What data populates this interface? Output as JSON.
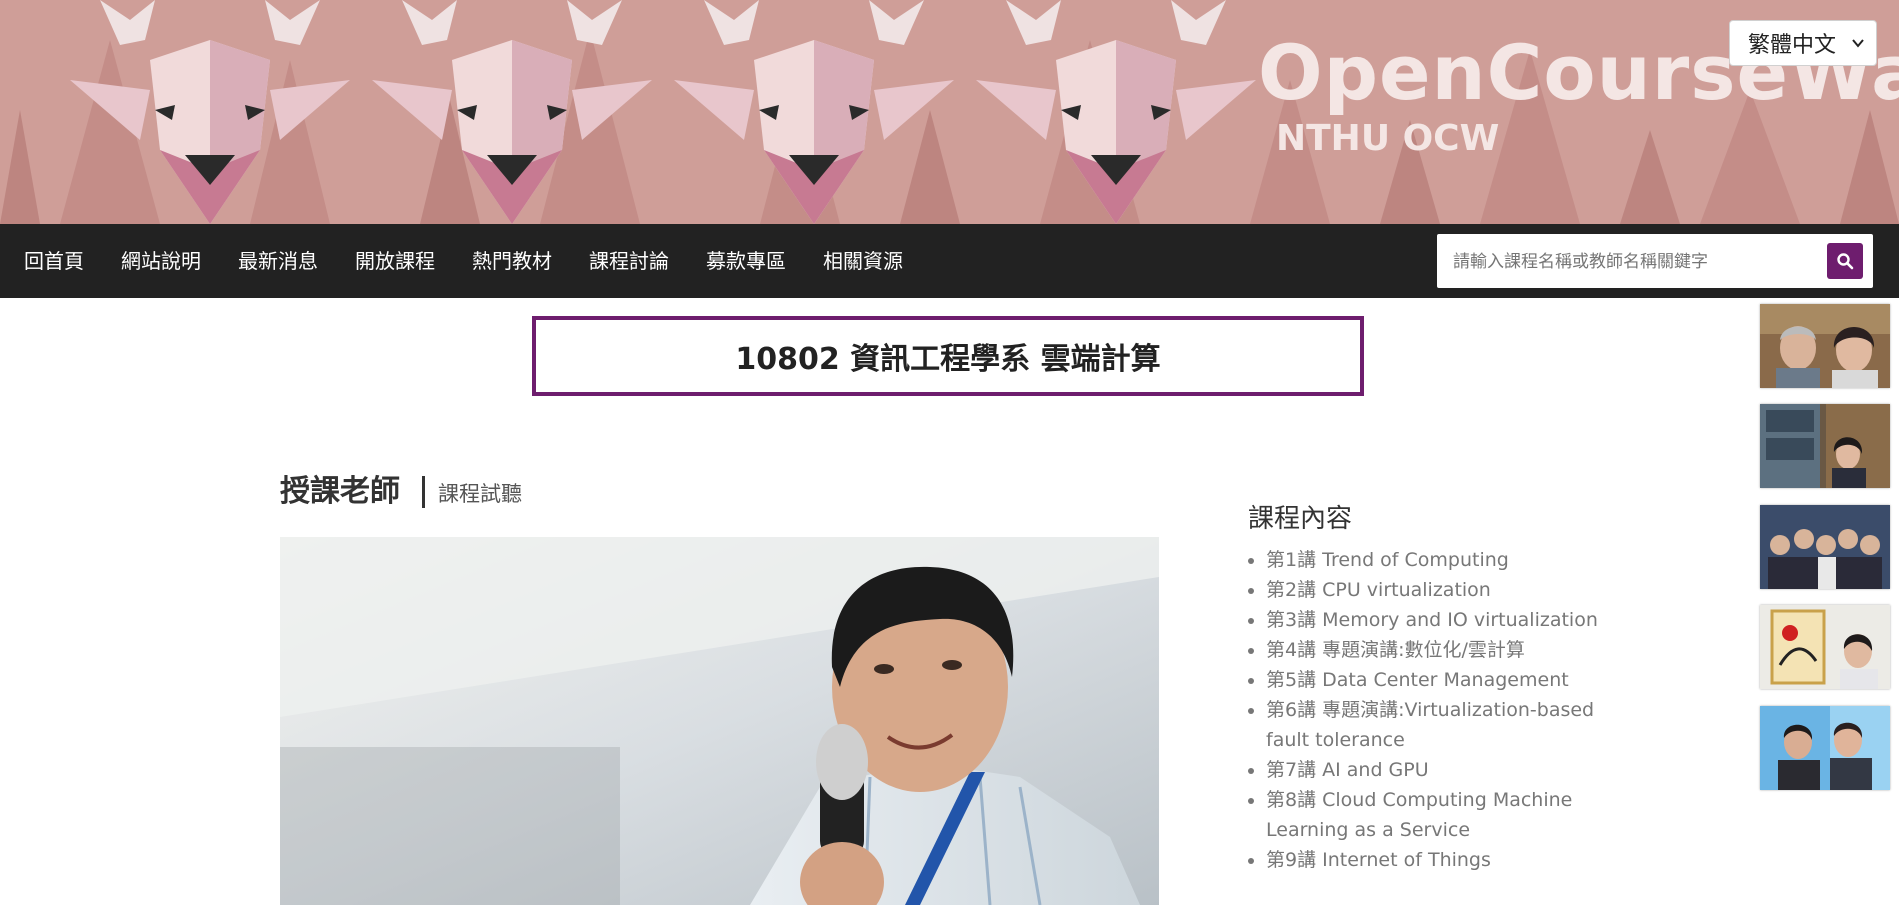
{
  "banner": {
    "brand_title": "OpenCourseWare",
    "brand_subtitle": "NTHU OCW",
    "language": "繁體中文",
    "colors": {
      "background": "#cf9e98",
      "deer_light": "#f2dede",
      "deer_mid": "#c97f95"
    }
  },
  "nav": {
    "items": [
      {
        "label": "回首頁"
      },
      {
        "label": "網站說明"
      },
      {
        "label": "最新消息"
      },
      {
        "label": "開放課程"
      },
      {
        "label": "熱門教材"
      },
      {
        "label": "課程討論"
      },
      {
        "label": "募款專區"
      },
      {
        "label": "相關資源"
      }
    ]
  },
  "search": {
    "placeholder": "請輸入課程名稱或教師名稱關鍵字",
    "icon": "search-icon"
  },
  "course": {
    "title": "10802 資訊工程學系 雲端計算"
  },
  "teacher": {
    "heading": "授課老師",
    "trial_link": "課程試聽"
  },
  "content": {
    "heading": "課程內容",
    "lectures": [
      "第1講 Trend of Computing",
      "第2講 CPU virtualization",
      "第3講 Memory and IO virtualization",
      "第4講 專題演講:數位化/雲計算",
      "第5講 Data Center Management",
      "第6講 專題演講:Virtualization-based fault tolerance",
      "第7講 AI and GPU",
      "第8講 Cloud Computing Machine Learning as a Service",
      "第9講 Internet of Things"
    ]
  },
  "colors": {
    "accent": "#6e1d6e",
    "nav_bg": "#222222"
  }
}
